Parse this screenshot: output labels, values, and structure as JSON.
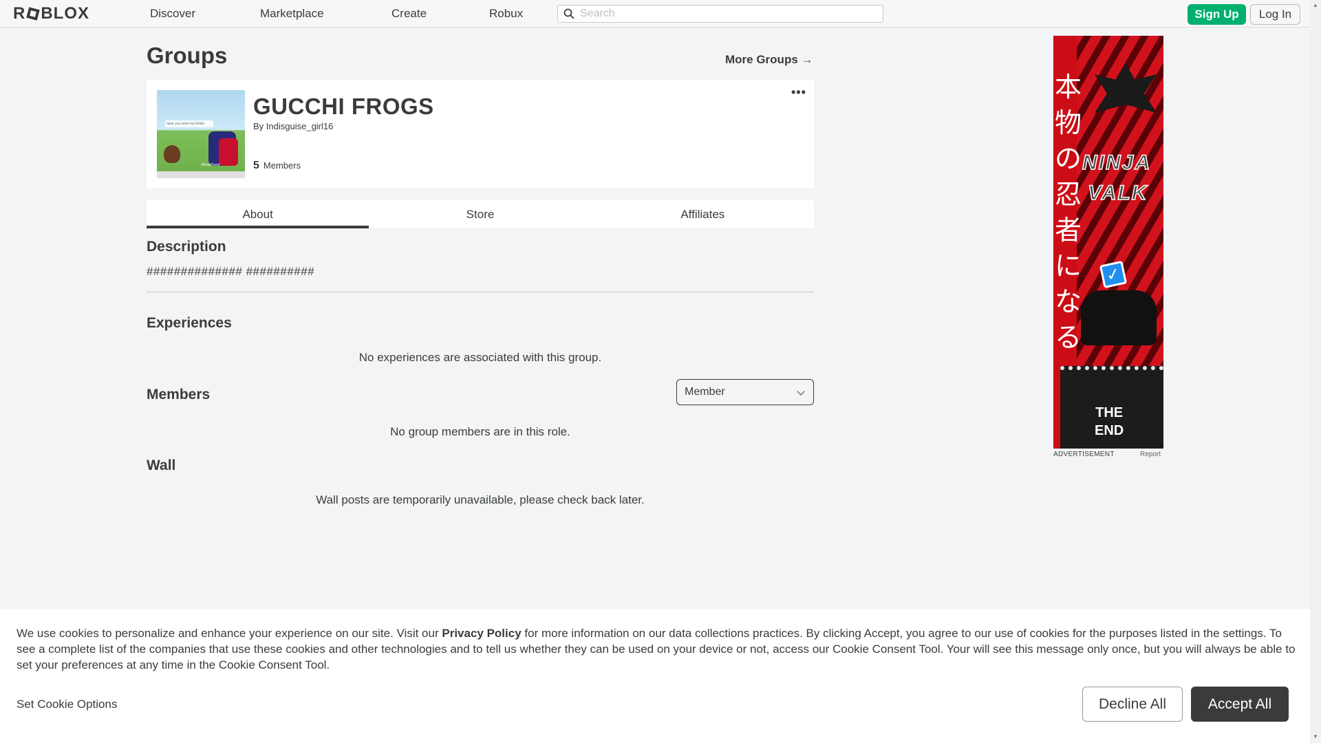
{
  "brand": {
    "logo_text": "ROBLOX",
    "accent_green": "#00b06f",
    "dark": "#393b3d"
  },
  "nav": {
    "links": [
      "Discover",
      "Marketplace",
      "Create",
      "Robux"
    ],
    "search_placeholder": "Search",
    "signup_label": "Sign Up",
    "login_label": "Log In"
  },
  "page": {
    "title": "Groups",
    "more_groups": "More Groups →"
  },
  "group": {
    "name": "GUCCHI FROGS",
    "by_label": "By",
    "owner": "Indisguise_girl16",
    "member_count": "5",
    "members_label": "Members",
    "thumb_caption": "have you seen my family",
    "thumb_tag": "#RoadTrend",
    "more_icon": "ellipsis-icon"
  },
  "tabs": [
    "About",
    "Store",
    "Affiliates"
  ],
  "about": {
    "description_title": "Description",
    "description_text": "############## ##########",
    "experiences_title": "Experiences",
    "experiences_empty": "No experiences are associated with this group.",
    "members_title": "Members",
    "role_selected": "Member",
    "members_empty": "No group members are in this role.",
    "wall_title": "Wall",
    "wall_message": "Wall posts are temporarily unavailable, please check back later."
  },
  "ad": {
    "kanji": "本物の忍者になる",
    "logo_line1": "NINJA",
    "logo_line2": "VALK",
    "body_text_line1": "THE",
    "body_text_line2": "END",
    "label": "ADVERTISEMENT",
    "report": "Report"
  },
  "cookie": {
    "text_before": "We use cookies to personalize and enhance your experience on our site. Visit our ",
    "privacy_link": "Privacy Policy",
    "text_after": " for more information on our data collections practices. By clicking Accept, you agree to our use of cookies for the purposes listed in the settings. To see a complete list of the companies that use these cookies and other technologies and to tell us whether they can be used on your device or not, access our Cookie Consent Tool. Your will see this message only once, but you will always be able to set your preferences at any time in the Cookie Consent Tool.",
    "set_options": "Set Cookie Options",
    "decline": "Decline All",
    "accept": "Accept All"
  }
}
